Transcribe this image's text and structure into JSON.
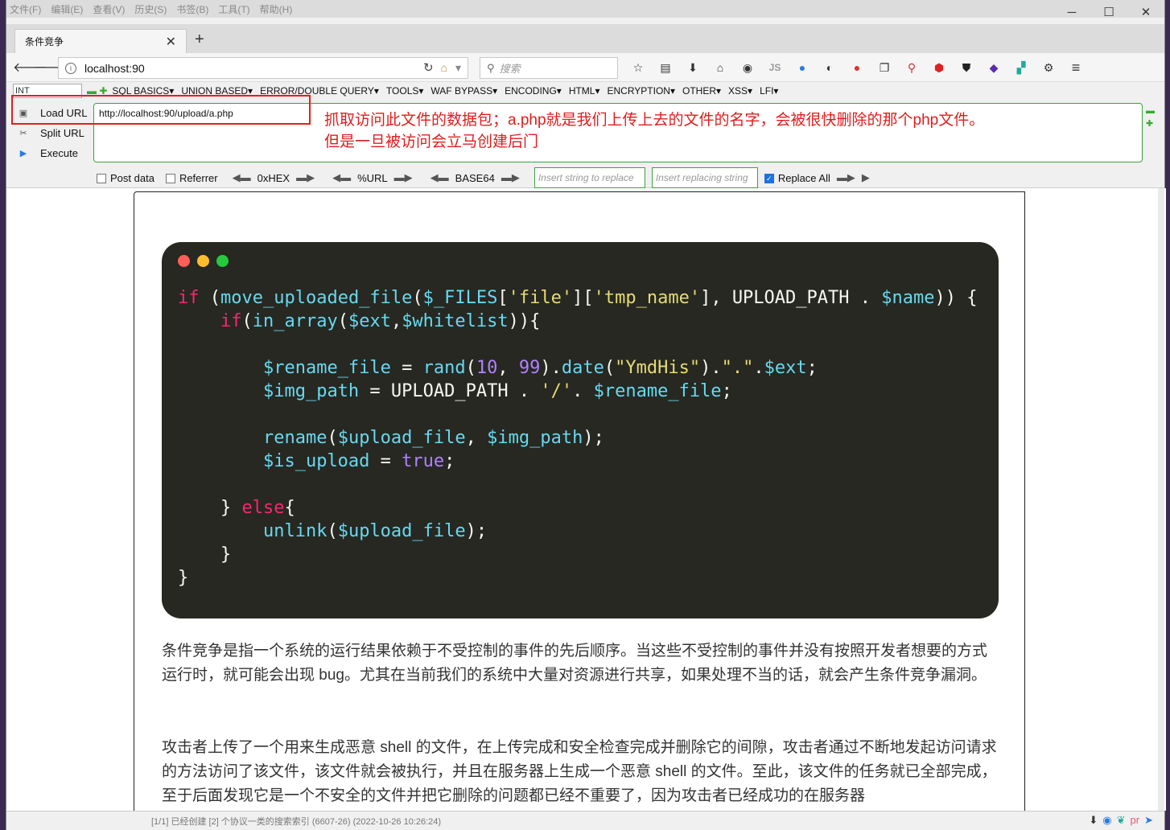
{
  "menu": [
    "文件(F)",
    "编辑(E)",
    "查看(V)",
    "历史(S)",
    "书签(B)",
    "工具(T)",
    "帮助(H)"
  ],
  "tab": {
    "title": "条件竞争"
  },
  "nav": {
    "url": "localhost:90",
    "search_placeholder": "搜索"
  },
  "toolbar_icons": [
    "bookmark-star-icon",
    "reader-icon",
    "download-icon",
    "home-icon",
    "globe-icon",
    "js-icon",
    "chrome-icon",
    "palette-icon",
    "ladybug-icon",
    "copy-icon",
    "zoom-icon",
    "adblock-icon",
    "shield-icon",
    "diamond-icon",
    "chart-icon",
    "gear-icon",
    "menu-icon"
  ],
  "hackbar": {
    "int_label": "INT",
    "menus": [
      "SQL BASICS▾",
      "UNION BASED▾",
      "ERROR/DOUBLE QUERY▾",
      "TOOLS▾",
      "WAF BYPASS▾",
      "ENCODING▾",
      "HTML▾",
      "ENCRYPTION▾",
      "OTHER▾",
      "XSS▾",
      "LFI▾"
    ],
    "load_url": "Load URL",
    "split_url": "Split URL",
    "execute": "Execute",
    "url_value": "http://localhost:90/upload/a.php",
    "post_data": "Post data",
    "referrer": "Referrer",
    "hex": "0xHEX",
    "urlenc": "%URL",
    "base64": "BASE64",
    "replace_placeholder": "Insert string to replace",
    "replacing_placeholder": "Insert replacing string",
    "replace_all": "Replace All"
  },
  "annotation": {
    "line1": "抓取访问此文件的数据包；a.php就是我们上传上去的文件的名字，会被很快删除的那个php文件。",
    "line2": "但是一旦被访问会立马创建后门"
  },
  "article": {
    "para1": "条件竞争是指一个系统的运行结果依赖于不受控制的事件的先后顺序。当这些不受控制的事件并没有按照开发者想要的方式运行时，就可能会出现 bug。尤其在当前我们的系统中大量对资源进行共享，如果处理不当的话，就会产生条件竞争漏洞。",
    "para2": "攻击者上传了一个用来生成恶意 shell 的文件，在上传完成和安全检查完成并删除它的间隙，攻击者通过不断地发起访问请求的方法访问了该文件，该文件就会被执行，并且在服务器上生成一个恶意 shell 的文件。至此，该文件的任务就已全部完成，至于后面发现它是一个不安全的文件并把它删除的问题都已经不重要了，因为攻击者已经成功的在服务器"
  },
  "status": {
    "text": "[1/1] 已经创建 [2] 个协议一类的搜索索引 (6607-26) (2022-10-26 10:26:24)"
  },
  "colors": {
    "code_bg": "#272822",
    "dot_red": "#ff5f56",
    "dot_yellow": "#ffbd2e",
    "dot_green": "#27c93f",
    "annotation": "#e01d1d",
    "green_border": "#3aa33a"
  }
}
